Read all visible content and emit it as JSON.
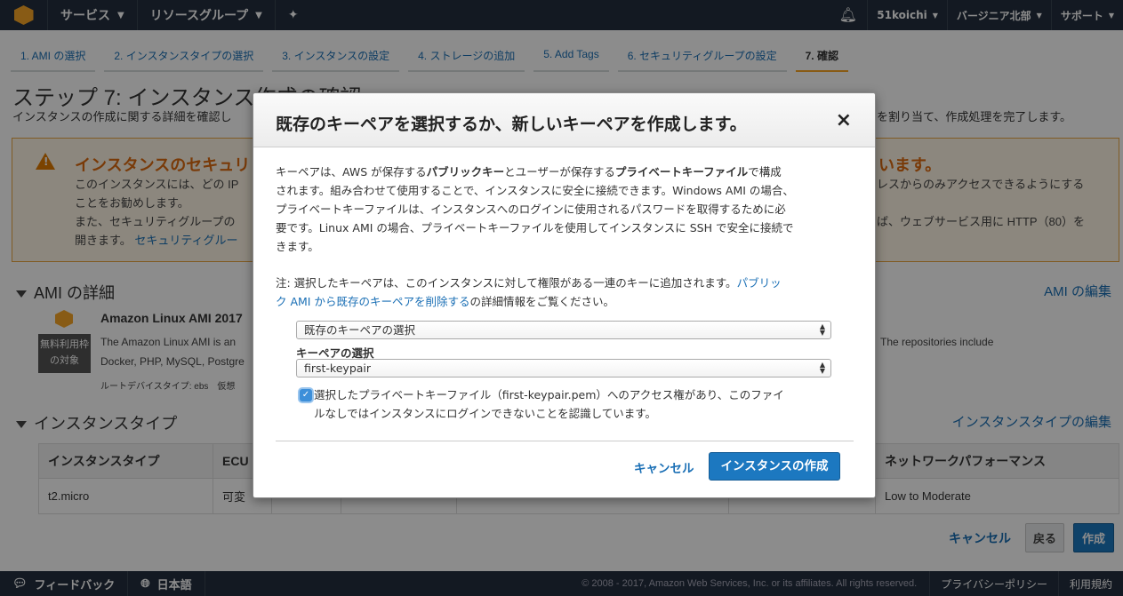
{
  "topnav": {
    "services": "サービス",
    "resource_groups": "リソースグループ",
    "user": "51koichi",
    "region": "バージニア北部",
    "support": "サポート"
  },
  "steps": [
    "1. AMI の選択",
    "2. インスタンスタイプの選択",
    "3. インスタンスの設定",
    "4. ストレージの追加",
    "5. Add Tags",
    "6. セキュリティグループの設定",
    "7. 確認"
  ],
  "page": {
    "title": "ステップ 7: インスタンス作成の確認",
    "desc_left": "インスタンスの作成に関する詳細を確認し",
    "desc_right": "を割り当て、作成処理を完了します。"
  },
  "warning": {
    "title_left": "インスタンスのセキュリ",
    "title_right": "います。",
    "line1_left": "このインスタンスには、どの IP",
    "line1_right": "レスからのみアクセスできるようにする",
    "line2": "ことをお勧めします。",
    "line3_left": "また、セキュリティグループの",
    "line3_right": "ば、ウェブサービス用に HTTP（80）を",
    "line4_left": "開きます。",
    "line4_link": "セキュリティグルー"
  },
  "ami": {
    "section": "AMI の詳細",
    "edit": "AMI の編集",
    "badge": "無料利用枠の対象",
    "name": "Amazon Linux AMI 2017",
    "desc1": "The Amazon Linux AMI is an",
    "desc1_right": "The repositories include",
    "desc2": "Docker, PHP, MySQL, Postgre",
    "meta": "ルートデバイスタイプ: ebs　仮想"
  },
  "instance": {
    "section": "インスタンスタイプ",
    "edit": "インスタンスタイプの編集",
    "headers": [
      "インスタンスタイプ",
      "ECU",
      "",
      "",
      "",
      "",
      "ネットワークパフォーマンス"
    ],
    "row": [
      "t2.micro",
      "可変",
      "",
      "",
      "",
      "",
      "Low to Moderate"
    ]
  },
  "actions": {
    "cancel": "キャンセル",
    "back": "戻る",
    "launch": "作成"
  },
  "footer": {
    "feedback": "フィードバック",
    "language": "日本語",
    "copyright": "© 2008 - 2017, Amazon Web Services, Inc. or its affiliates. All rights reserved.",
    "privacy": "プライバシーポリシー",
    "terms": "利用規約"
  },
  "modal": {
    "title": "既存のキーペアを選択するか、新しいキーペアを作成します。",
    "close": "×",
    "p1": {
      "l1a": "キーペアは、AWS が保存する",
      "l1b": "パブリックキー",
      "l1c": "とユーザーが保存する",
      "l1d": "プライベートキーファイル",
      "l1e": "で構成",
      "l2": "されます。組み合わせて使用することで、インスタンスに安全に接続できます。Windows AMI の場合、",
      "l3": "プライベートキーファイルは、インスタンスへのログインに使用されるパスワードを取得するために必",
      "l4": "要です。Linux AMI の場合、プライベートキーファイルを使用してインスタンスに SSH で安全に接続で",
      "l5": "きます。"
    },
    "p2": {
      "l1": "注: 選択したキーペアは、このインスタンスに対して権限がある一連のキーに追加されます。",
      "l1_link": "パブリッ",
      "l2_link": "ク AMI から既存のキーペアを削除する",
      "l2": "の詳細情報をご覧ください。"
    },
    "select1": "既存のキーペアの選択",
    "select_label": "キーペアの選択",
    "select2": "first-keypair",
    "check_l1": "選択したプライベートキーファイル（first-keypair.pem）へのアクセス権があり、このファイ",
    "check_l2": "ルなしではインスタンスにログインできないことを認識しています。",
    "cancel": "キャンセル",
    "launch": "インスタンスの作成"
  }
}
